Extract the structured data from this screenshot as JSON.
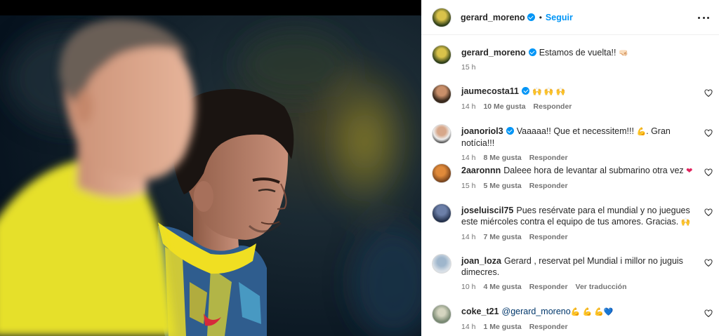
{
  "post": {
    "author": "gerard_moreno",
    "follow_label": "Seguir",
    "separator": "•",
    "caption": {
      "username": "gerard_moreno",
      "text": "Estamos de vuelta!! ",
      "emoji": "🤜🏻",
      "time": "15 h"
    }
  },
  "comments": [
    {
      "username": "jaumecosta11",
      "verified": true,
      "text": "",
      "emoji": "🙌 🙌 🙌",
      "time": "14 h",
      "likes": "10 Me gusta",
      "reply": "Responder"
    },
    {
      "username": "joanoriol3",
      "verified": true,
      "text": "Vaaaaa!! Que et necessitem!!! ",
      "emoji": "💪",
      "text2": ". Gran notícia!!!",
      "time": "14 h",
      "likes": "8 Me gusta",
      "reply": "Responder"
    },
    {
      "username": "2aaronnn",
      "verified": false,
      "text": "Daleee hora de levantar al submarino otra vez ",
      "emoji": "❤",
      "time": "15 h",
      "likes": "5 Me gusta",
      "reply": "Responder"
    },
    {
      "username": "joseluiscil75",
      "verified": false,
      "text": "Pues resérvate para el mundial y no juegues este miércoles contra el equipo de tus amores. Gracias. ",
      "emoji": "🙌",
      "time": "14 h",
      "likes": "7 Me gusta",
      "reply": "Responder"
    },
    {
      "username": "joan_loza",
      "verified": false,
      "text": "Gerard , reservat pel Mundial i millor no juguis dimecres.",
      "time": "10 h",
      "likes": "4 Me gusta",
      "reply": "Responder",
      "translate": "Ver traducción"
    },
    {
      "username": "coke_t21",
      "verified": false,
      "mention": "@gerard_moreno",
      "emoji": " 💪 💪 💪 ",
      "emoji2": "💙",
      "time": "14 h",
      "likes": "1 Me gusta",
      "reply": "Responder"
    }
  ],
  "colors": {
    "accent": "#0095f6",
    "photo_bg": "#05101c",
    "jersey_yellow": "#f2e21b"
  }
}
